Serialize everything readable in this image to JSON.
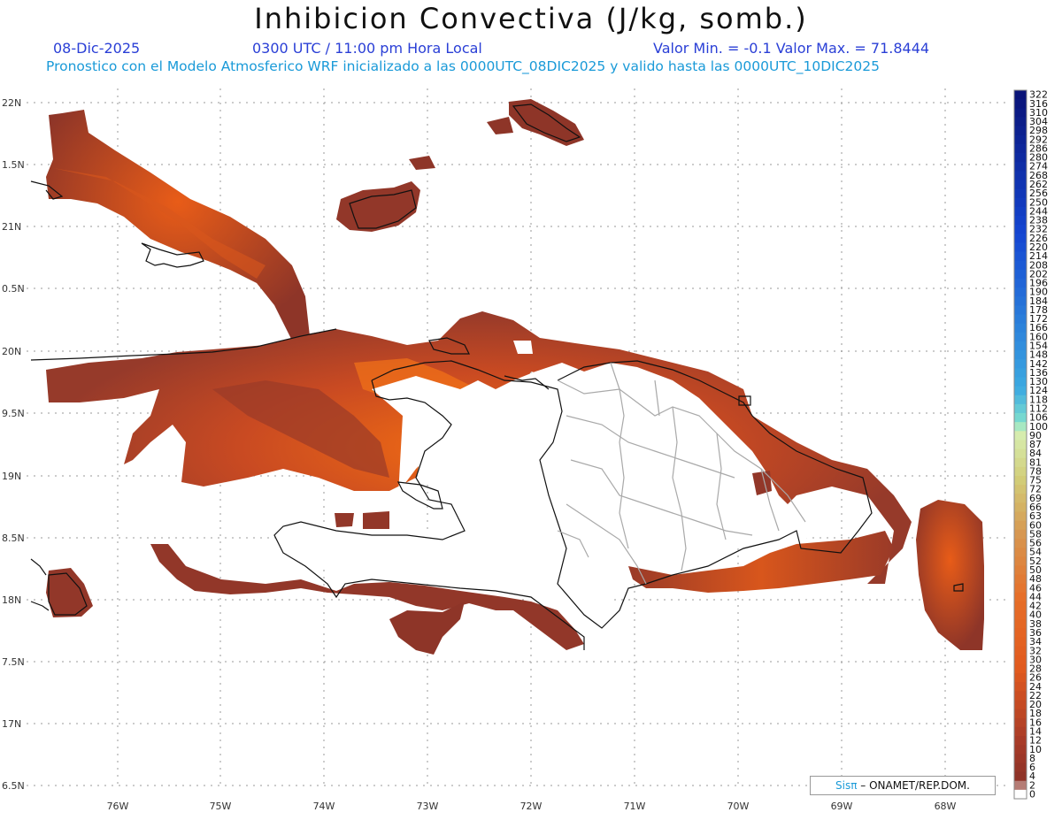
{
  "header": {
    "title": "Inhibicion Convectiva (J/kg, somb.)",
    "date": "08-Dic-2025",
    "time": "0300 UTC / 11:00 pm Hora Local",
    "minmax": "Valor Min. = -0.1  Valor Max. = 71.8444",
    "forecast": "Pronostico con el Modelo Atmosferico WRF inicializado a las 0000UTC_08DIC2025 y valido hasta las  0000UTC_10DIC2025"
  },
  "axes": {
    "lon_labels": [
      "76W",
      "75W",
      "74W",
      "73W",
      "72W",
      "71W",
      "70W",
      "69W",
      "68W"
    ],
    "lat_labels": [
      "22N",
      "1.5N",
      "21N",
      "0.5N",
      "20N",
      "9.5N",
      "19N",
      "8.5N",
      "18N",
      "7.5N",
      "17N",
      "6.5N"
    ]
  },
  "colorbar": {
    "labels": [
      "322",
      "316",
      "310",
      "304",
      "298",
      "292",
      "286",
      "280",
      "274",
      "268",
      "262",
      "256",
      "250",
      "244",
      "238",
      "232",
      "226",
      "220",
      "214",
      "208",
      "202",
      "196",
      "190",
      "184",
      "178",
      "172",
      "166",
      "160",
      "154",
      "148",
      "142",
      "136",
      "130",
      "124",
      "118",
      "112",
      "106",
      "100",
      "90",
      "87",
      "84",
      "81",
      "78",
      "75",
      "72",
      "69",
      "66",
      "63",
      "60",
      "58",
      "56",
      "54",
      "52",
      "50",
      "48",
      "46",
      "44",
      "42",
      "40",
      "38",
      "36",
      "34",
      "32",
      "30",
      "28",
      "26",
      "24",
      "22",
      "20",
      "18",
      "16",
      "14",
      "12",
      "10",
      "8",
      "6",
      "4",
      "2",
      "0"
    ]
  },
  "credit": {
    "sis": "Sisπ",
    "org": " – ONAMET/REP.DOM."
  },
  "colors": {
    "dark_fill": "#8a3628",
    "mid_fill": "#c44a22",
    "bright_fill": "#f06a14",
    "coast": "#111111",
    "borders": "#a9a9a9"
  }
}
